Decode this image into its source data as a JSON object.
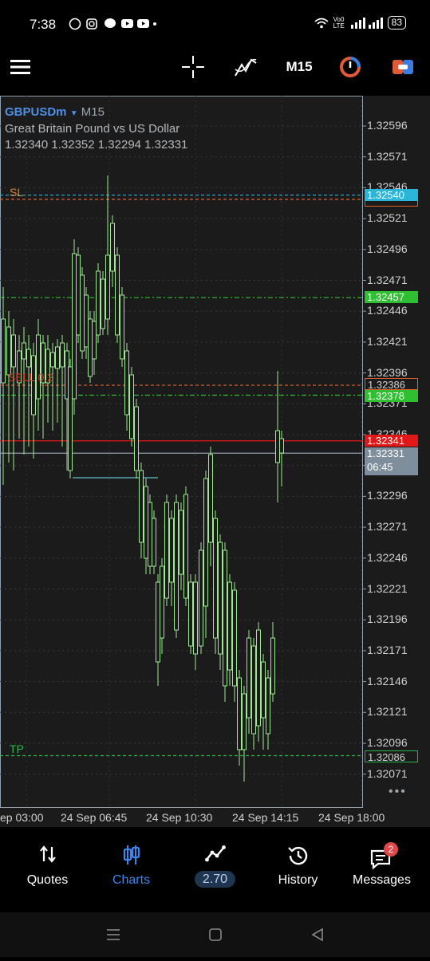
{
  "status_bar": {
    "time": "7:38",
    "notifications": [
      "whatsapp-icon",
      "instagram-icon",
      "chat-icon",
      "youtube-icon",
      "youtube-icon",
      "dot-icon"
    ],
    "network": "Vo0 LTE",
    "battery": "83"
  },
  "toolbar": {
    "timeframe": "M15"
  },
  "chart": {
    "symbol": "GBPUSDm",
    "timeframe": "M15",
    "description": "Great Britain Pound vs US Dollar",
    "ohlc": "1.32340 1.32352 1.32294 1.32331",
    "price_ticks": [
      "1.32596",
      "1.32571",
      "1.32546",
      "1.32521",
      "1.32496",
      "1.32471",
      "1.32446",
      "1.32421",
      "1.32396",
      "1.32371",
      "1.32346",
      "1.32321",
      "1.32296",
      "1.32271",
      "1.32246",
      "1.32221",
      "1.32196",
      "1.32171",
      "1.32146",
      "1.32121",
      "1.32096",
      "1.32071"
    ],
    "lines": {
      "sl_label": "SL",
      "sl_price": "1.32540",
      "sell_label": "SELL 0.2",
      "sell_price": "1.32386",
      "green_upper": "1.32457",
      "green_lower": "1.32378",
      "bid_price": "1.32341",
      "current_price": "1.32331",
      "countdown": "06:45",
      "tp_label": "TP",
      "tp_price": "1.32086"
    },
    "colors": {
      "bull": "#9eea90",
      "sl_line": "#e06030",
      "sl_box": "#29b6d8",
      "green_level": "#2ec030",
      "bid_line": "#e01818",
      "current_box": "#8090a0",
      "tp_line": "#2bb34b"
    }
  },
  "x_axis": {
    "labels": [
      "ep 03:00",
      "24 Sep 06:45",
      "24 Sep 10:30",
      "24 Sep 14:15",
      "24 Sep 18:00"
    ]
  },
  "bottom_nav": {
    "items": [
      {
        "label": "Quotes",
        "icon": "quotes-icon",
        "active": false
      },
      {
        "label": "Charts",
        "icon": "charts-icon",
        "active": true
      },
      {
        "label": "2.70",
        "icon": "trade-icon",
        "active": false
      },
      {
        "label": "History",
        "icon": "history-icon",
        "active": false
      },
      {
        "label": "Messages",
        "icon": "messages-icon",
        "active": false,
        "badge": "2"
      }
    ]
  }
}
